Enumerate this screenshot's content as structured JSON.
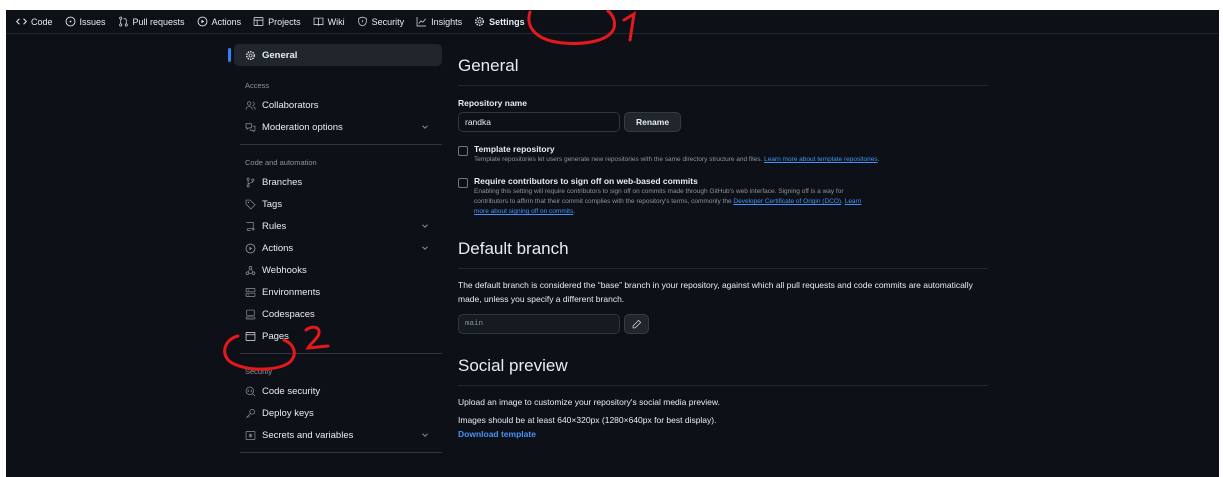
{
  "nav": {
    "tabs": [
      {
        "label": "Code",
        "icon": "code-icon"
      },
      {
        "label": "Issues",
        "icon": "issue-opened-icon"
      },
      {
        "label": "Pull requests",
        "icon": "git-pull-request-icon"
      },
      {
        "label": "Actions",
        "icon": "play-icon"
      },
      {
        "label": "Projects",
        "icon": "table-icon"
      },
      {
        "label": "Wiki",
        "icon": "book-icon"
      },
      {
        "label": "Security",
        "icon": "shield-icon"
      },
      {
        "label": "Insights",
        "icon": "graph-icon"
      },
      {
        "label": "Settings",
        "icon": "gear-icon"
      }
    ],
    "selected": "Settings"
  },
  "sidebar": {
    "general": "General",
    "access_heading": "Access",
    "collaborators": "Collaborators",
    "moderation": "Moderation options",
    "code_heading": "Code and automation",
    "branches": "Branches",
    "tags": "Tags",
    "rules": "Rules",
    "actions": "Actions",
    "webhooks": "Webhooks",
    "environments": "Environments",
    "codespaces": "Codespaces",
    "pages": "Pages",
    "security_heading": "Security",
    "code_security": "Code security",
    "deploy_keys": "Deploy keys",
    "secrets": "Secrets and variables"
  },
  "main": {
    "title": "General",
    "repo_name_label": "Repository name",
    "repo_name_value": "randka",
    "rename_button": "Rename",
    "template_title": "Template repository",
    "template_desc": "Template repositories let users generate new repositories with the same directory structure and files.",
    "template_link": "Learn more about template repositories",
    "template_end": ".",
    "signoff_title": "Require contributors to sign off on web-based commits",
    "signoff_desc1": "Enabling this setting will require contributors to sign off on commits made through GitHub's web interface. Signing off is a way for",
    "signoff_desc2": "contributors to affirm that their commit complies with the repository's terms, commonly the",
    "signoff_link1": "Developer Certificate of Origin (DCO)",
    "signoff_mid": ". ",
    "signoff_link2a": "Learn",
    "signoff_link2b": "more about signing off on commits",
    "signoff_end": ".",
    "default_branch_title": "Default branch",
    "default_branch_desc": "The default branch is considered the “base” branch in your repository, against which all pull requests and code commits are automatically made, unless you specify a different branch.",
    "default_branch_value": "main",
    "social_title": "Social preview",
    "social_desc1": "Upload an image to customize your repository's social media preview.",
    "social_desc2": "Images should be at least 640×320px (1280×640px for best display).",
    "download_link": "Download template"
  },
  "annotations": {
    "one": "1",
    "two": "2",
    "color": "#e5181b"
  },
  "colors": {
    "bg": "#0d1117",
    "accent": "#2f81f7",
    "link": "#4493f8",
    "muted": "#8b949e"
  }
}
